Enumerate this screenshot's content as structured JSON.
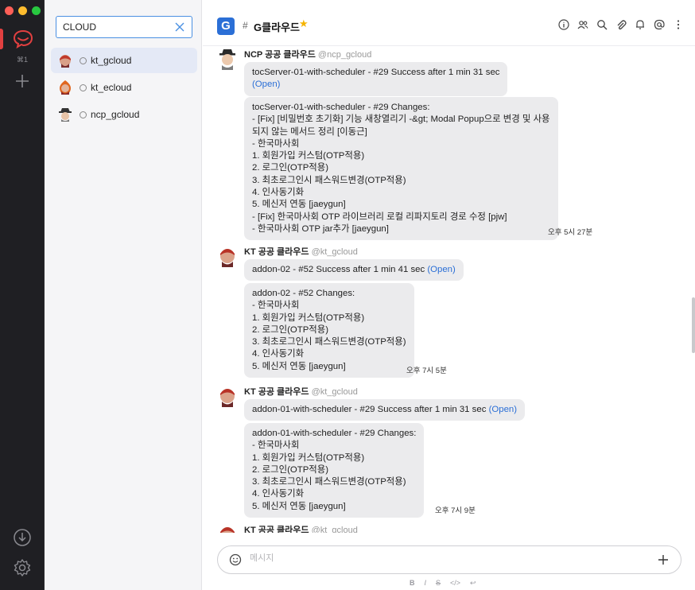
{
  "rail": {
    "workspace_shortcut": "⌘1",
    "colors": {
      "accent": "#e24040",
      "traffic": [
        "#ff5f57",
        "#febc2e",
        "#28c840"
      ]
    }
  },
  "search": {
    "value": "CLOUD"
  },
  "channels": [
    {
      "label": "kt_gcloud",
      "avatar": "jenkins-red-icon",
      "active": true
    },
    {
      "label": "kt_ecloud",
      "avatar": "jenkins-fire-icon",
      "active": false
    },
    {
      "label": "ncp_gcloud",
      "avatar": "jenkins-hat-icon",
      "active": false
    }
  ],
  "header": {
    "avatar_letter": "G",
    "hash": "#",
    "title": "G클라우드",
    "star": "★"
  },
  "messages": [
    {
      "sender": "NCP 공공 클라우드",
      "handle": "@ncp_gcloud",
      "bubble1": [
        "tocServer-01-with-scheduler - #29 Success after 1 min 31 sec"
      ],
      "bubble1_link": "(Open)",
      "bubble2": [
        "tocServer-01-with-scheduler - #29 Changes:",
        "- [Fix] [비밀번호 초기화] 기능 새창열리기 -&gt; Modal Popup으로 변경 및 사용",
        "되지 않는 메서드 정리 [이동근]",
        "- 한국마사회",
        "1. 회원가입 커스텀(OTP적용)",
        "2. 로그인(OTP적용)",
        "3. 최초로그인시 패스워드변경(OTP적용)",
        "4. 인사동기화",
        "5. 메신저 연동 [jaeygun]",
        "- [Fix] 한국마사회 OTP 라이브러리 로컬 리파지토리 경로 수정 [pjw]",
        "- 한국마사회 OTP jar추가 [jaeygun]"
      ],
      "time": "오후 5시 27분"
    },
    {
      "sender": "KT 공공 클라우드",
      "handle": "@kt_gcloud",
      "bubble1": [
        "addon-02 - #52 Success after 1 min 41 sec "
      ],
      "bubble1_link": "(Open)",
      "bubble2": [
        "addon-02 - #52 Changes:",
        "- 한국마사회",
        "1. 회원가입 커스텀(OTP적용)",
        "2. 로그인(OTP적용)",
        "3. 최초로그인시 패스워드변경(OTP적용)",
        "4. 인사동기화",
        "5. 메신저 연동 [jaeygun]"
      ],
      "time": "오후 7시 5분"
    },
    {
      "sender": "KT 공공 클라우드",
      "handle": "@kt_gcloud",
      "bubble1": [
        "addon-01-with-scheduler - #29 Success after 1 min 31 sec "
      ],
      "bubble1_link": "(Open)",
      "bubble2": [
        "addon-01-with-scheduler - #29 Changes:",
        "- 한국마사회",
        "1. 회원가입 커스텀(OTP적용)",
        "2. 로그인(OTP적용)",
        "3. 최초로그인시 패스워드변경(OTP적용)",
        "4. 인사동기화",
        "5. 메신저 연동 [jaeygun]"
      ],
      "time": "오후 7시 9분"
    },
    {
      "sender": "KT 공공 클라우드",
      "handle": "@kt_gcloud"
    }
  ],
  "composer": {
    "placeholder": "메시지"
  },
  "format_bar": {
    "bold": "B",
    "italic": "I",
    "strike": "S",
    "code": "</>",
    "enter": "↩"
  }
}
